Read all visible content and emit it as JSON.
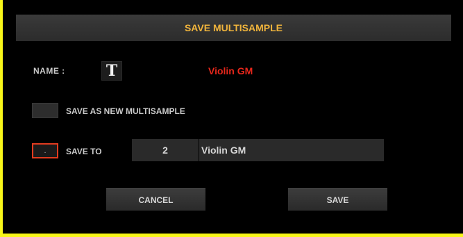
{
  "dialog": {
    "title": "SAVE MULTISAMPLE",
    "name_label": "NAME :",
    "text_edit_icon": "T",
    "name_value": "Violin GM",
    "save_as_new_label": "SAVE AS NEW MULTISAMPLE",
    "save_to_label": "SAVE TO",
    "save_to_marker": ".",
    "slot_number": "2",
    "slot_name": "Violin GM",
    "cancel_label": "CANCEL",
    "save_label": "SAVE"
  },
  "colors": {
    "frame": "#f8f61a",
    "background": "#000000",
    "title": "#f0b43c",
    "name_value": "#e8271b",
    "selected_checkbox_border": "#e23b1f"
  }
}
